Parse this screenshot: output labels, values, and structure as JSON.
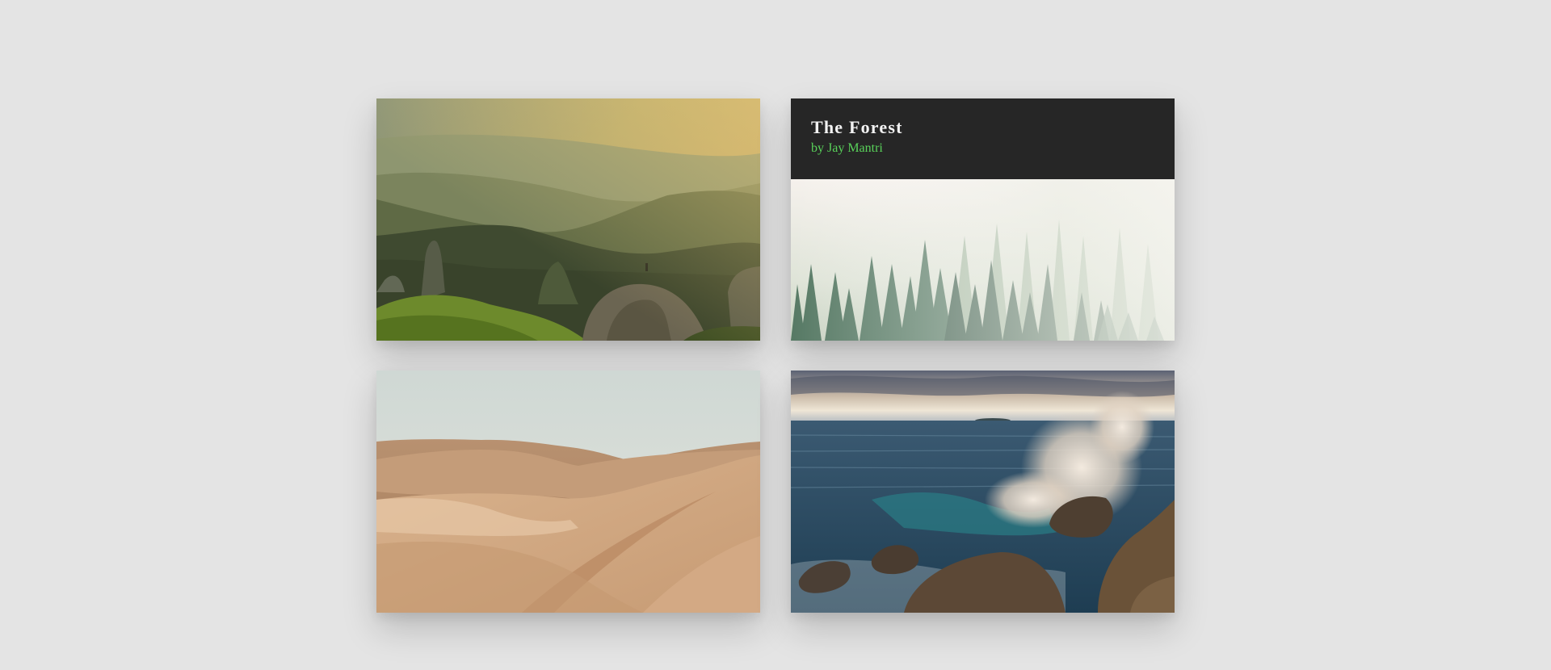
{
  "gallery": {
    "cards": [
      {
        "icon": "mountain-landscape-image"
      },
      {
        "icon": "forest-landscape-image",
        "title": "The Forest",
        "author": "by Jay Mantri"
      },
      {
        "icon": "desert-landscape-image"
      },
      {
        "icon": "ocean-landscape-image"
      }
    ]
  },
  "colors": {
    "page_background": "#e4e4e4",
    "caption_background": "#262626",
    "caption_title": "#f2f2f2",
    "caption_author": "#59d25a"
  }
}
